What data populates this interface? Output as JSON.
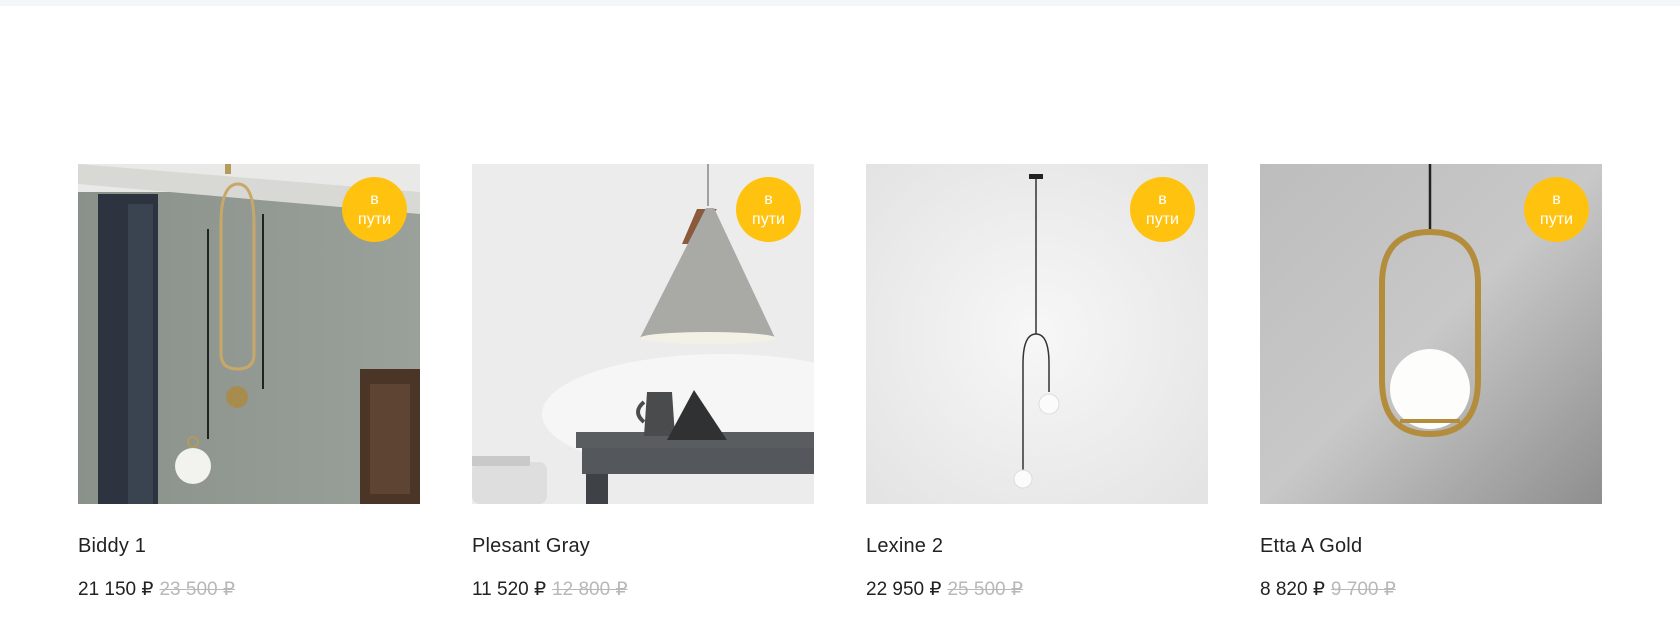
{
  "products": [
    {
      "name": "Biddy 1",
      "price": "21 150 ₽",
      "old_price": "23 500 ₽",
      "badge_line1": "в",
      "badge_line2": "пути",
      "image": "brass-pendant-lamp-photo"
    },
    {
      "name": "Plesant Gray",
      "price": "11 520 ₽",
      "old_price": "12 800 ₽",
      "badge_line1": "в",
      "badge_line2": "пути",
      "image": "gray-cone-pendant-lamp-photo"
    },
    {
      "name": "Lexine 2",
      "price": "22 950 ₽",
      "old_price": "25 500 ₽",
      "badge_line1": "в",
      "badge_line2": "пути",
      "image": "black-wire-pendant-lamp-photo"
    },
    {
      "name": "Etta A Gold",
      "price": "8 820 ₽",
      "old_price": "9 700 ₽",
      "badge_line1": "в",
      "badge_line2": "пути",
      "image": "gold-ring-pendant-lamp-photo"
    }
  ],
  "colors": {
    "badge": "#ffc20e",
    "old_price": "#b8b8b8",
    "text": "#222222"
  }
}
